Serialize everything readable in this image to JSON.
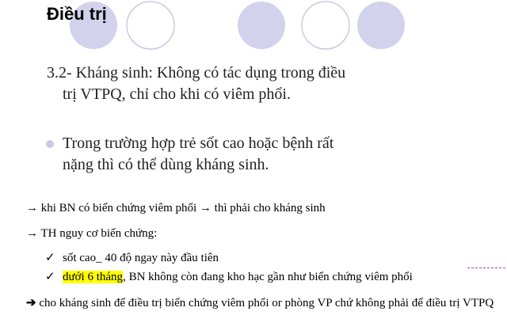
{
  "slide": {
    "title": "Điều trị",
    "para1": {
      "line1": "3.2- Kháng sinh:  Không có tác dụng trong điều",
      "line2": "trị VTPQ, chỉ cho khi có viêm phổi."
    },
    "para2": {
      "line1": "Trong trường hợp trẻ sốt cao hoặc bệnh rất",
      "line2": "nặng thì có thể dùng kháng sinh."
    },
    "colors": {
      "circle_fill": "#d2d2ec",
      "circle_stroke": "#c9c9e6",
      "bullet": "#c9c9eb",
      "highlight": "#ffff00"
    }
  },
  "notes": {
    "note1": {
      "arrow": "→",
      "text": " khi BN có biến chứng viêm phổi → thì phải cho kháng sinh"
    },
    "note2": {
      "arrow": "→",
      "text": " TH nguy cơ biến chứng:"
    },
    "check1": {
      "mark": "✓",
      "text": "sốt cao_ 40 độ ngay này đầu tiên"
    },
    "check2": {
      "mark": "✓",
      "highlighted": "dưới 6 tháng",
      "text": ", BN không còn đang kho hạc gần như biển chứng viêm phổi"
    },
    "note3": {
      "arrow": "➔",
      "text": " cho kháng sinh để điều trị biến chứng viêm phổi or phòng VP chứ không phải để điều trị VTPQ"
    }
  }
}
